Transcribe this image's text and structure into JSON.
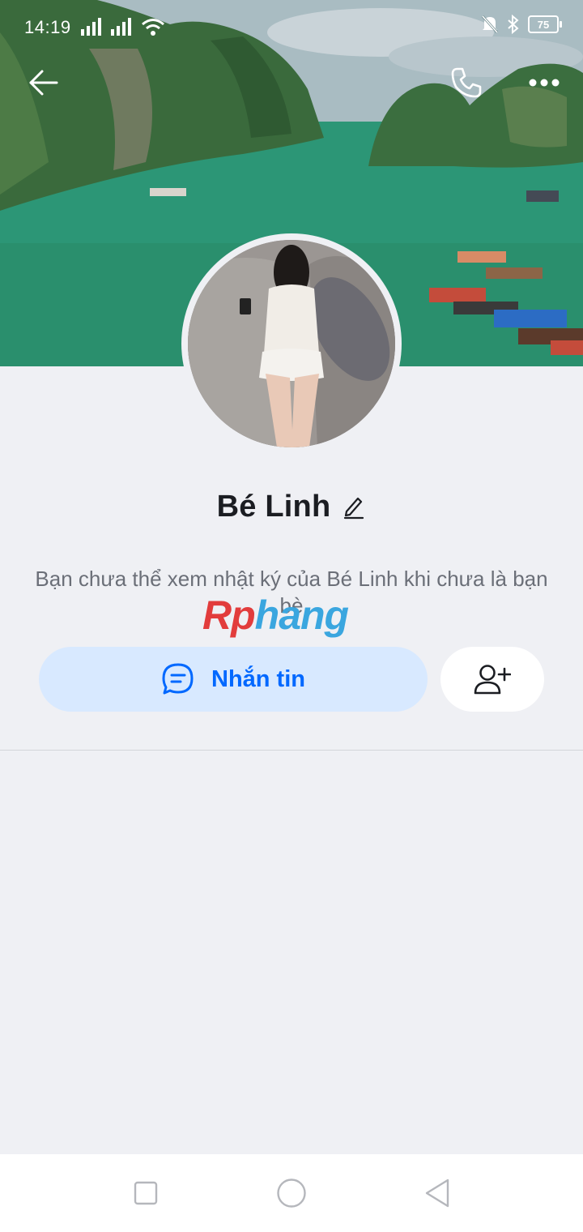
{
  "status_bar": {
    "time": "14:19",
    "battery": "75",
    "icons": [
      "signal-icon",
      "signal-icon",
      "wifi-icon",
      "mute-icon",
      "bluetooth-icon",
      "battery-icon"
    ]
  },
  "header": {
    "back_icon": "arrow-left-icon",
    "call_icon": "phone-icon",
    "more_icon": "more-dots-icon"
  },
  "profile": {
    "name": "Bé Linh",
    "edit_icon": "pencil-icon",
    "notice": "Bạn chưa thể xem nhật ký của Bé Linh khi chưa là bạn bè"
  },
  "watermark": {
    "part1": "Rp",
    "part2": "hang"
  },
  "actions": {
    "message_label": "Nhắn tin",
    "message_icon": "chat-bubble-icon",
    "add_friend_icon": "add-user-icon"
  },
  "colors": {
    "accent": "#0068ff",
    "message_bg": "#d8e9ff",
    "page_bg": "#eff0f4"
  },
  "system_nav": [
    "recent-apps-icon",
    "home-icon",
    "back-triangle-icon"
  ]
}
